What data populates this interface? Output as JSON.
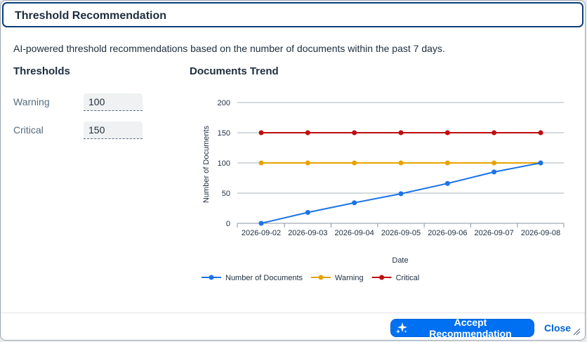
{
  "dialog": {
    "title": "Threshold Recommendation",
    "description": "AI-powered threshold recommendations based on the number of documents within the past 7 days."
  },
  "thresholds": {
    "title": "Thresholds",
    "warning_label": "Warning",
    "warning_value": "100",
    "critical_label": "Critical",
    "critical_value": "150"
  },
  "trend": {
    "title": "Documents Trend"
  },
  "chart_data": {
    "type": "line",
    "title": "Documents Trend",
    "xlabel": "Date",
    "ylabel": "Number of Documents",
    "ylim": [
      0,
      200
    ],
    "yticks": [
      0,
      50,
      100,
      150,
      200
    ],
    "grid": true,
    "legend_position": "bottom",
    "categories": [
      "2026-09-02",
      "2026-09-03",
      "2026-09-04",
      "2026-09-05",
      "2026-09-06",
      "2026-09-07",
      "2026-09-08"
    ],
    "series": [
      {
        "name": "Number of Documents",
        "color": "#1a73e8",
        "values": [
          0,
          18,
          34,
          49,
          66,
          85,
          100
        ]
      },
      {
        "name": "Warning",
        "color": "#e8a200",
        "values": [
          100,
          100,
          100,
          100,
          100,
          100,
          100
        ]
      },
      {
        "name": "Critical",
        "color": "#c00d0d",
        "values": [
          150,
          150,
          150,
          150,
          150,
          150,
          150
        ]
      }
    ]
  },
  "footer": {
    "accept_label": "Accept Recommendation",
    "close_label": "Close"
  },
  "colors": {
    "accent": "#0070f2",
    "header_border": "#0a3e79"
  },
  "icons": {
    "accept": "sparkle-icon",
    "resize": "resize-grip-icon"
  }
}
